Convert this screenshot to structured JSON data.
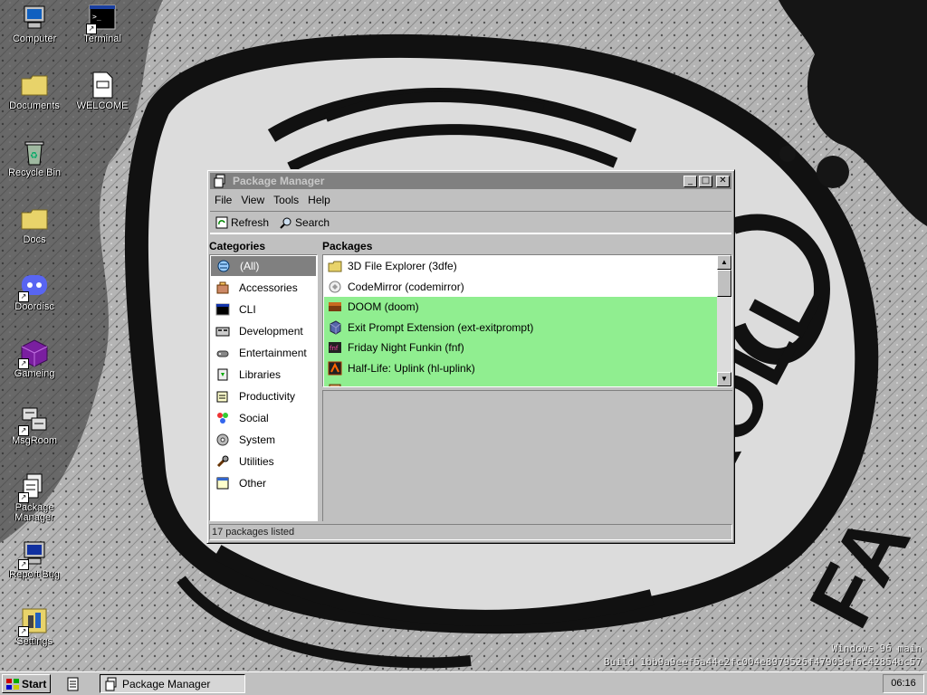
{
  "wallpaper": {
    "text_line1": "Windows 96 main",
    "text_line2": "Build 1bb9a9eef5a44e2fc004e8979526f47903ef6c42854bc57"
  },
  "desktop_icons": [
    {
      "label": "Computer",
      "icon": "computer-icon",
      "shortcut": false
    },
    {
      "label": "Terminal",
      "icon": "terminal-icon",
      "shortcut": true
    },
    {
      "label": "Documents",
      "icon": "folder-icon",
      "shortcut": false
    },
    {
      "label": "WELCOME",
      "icon": "document-icon",
      "shortcut": false
    },
    {
      "label": "Recycle Bin",
      "icon": "recycle-bin-icon",
      "shortcut": false
    },
    {
      "label": "Docs",
      "icon": "folder-icon",
      "shortcut": false
    },
    {
      "label": "Doordisc",
      "icon": "discord-icon",
      "shortcut": true
    },
    {
      "label": "Gameing",
      "icon": "game-cube-icon",
      "shortcut": true
    },
    {
      "label": "MsgRoom",
      "icon": "chat-computers-icon",
      "shortcut": true
    },
    {
      "label": "Package Manager",
      "icon": "package-manager-icon",
      "shortcut": true
    },
    {
      "label": "Report Bug",
      "icon": "computer-bug-icon",
      "shortcut": true
    },
    {
      "label": "Settings",
      "icon": "settings-icon",
      "shortcut": true
    }
  ],
  "window": {
    "title": "Package Manager",
    "menu": [
      "File",
      "View",
      "Tools",
      "Help"
    ],
    "toolbar": {
      "refresh_label": "Refresh",
      "search_label": "Search"
    },
    "categories_heading": "Categories",
    "packages_heading": "Packages",
    "categories": [
      {
        "label": "(All)",
        "icon": "all-icon",
        "selected": true
      },
      {
        "label": "Accessories",
        "icon": "accessories-icon",
        "selected": false
      },
      {
        "label": "CLI",
        "icon": "cli-icon",
        "selected": false
      },
      {
        "label": "Development",
        "icon": "development-icon",
        "selected": false
      },
      {
        "label": "Entertainment",
        "icon": "entertainment-icon",
        "selected": false
      },
      {
        "label": "Libraries",
        "icon": "libraries-icon",
        "selected": false
      },
      {
        "label": "Productivity",
        "icon": "productivity-icon",
        "selected": false
      },
      {
        "label": "Social",
        "icon": "social-icon",
        "selected": false
      },
      {
        "label": "System",
        "icon": "system-icon",
        "selected": false
      },
      {
        "label": "Utilities",
        "icon": "utilities-icon",
        "selected": false
      },
      {
        "label": "Other",
        "icon": "other-icon",
        "selected": false
      }
    ],
    "packages": [
      {
        "label": "3D File Explorer (3dfe)",
        "icon": "folder-icon",
        "installed": false
      },
      {
        "label": "CodeMirror (codemirror)",
        "icon": "codemirror-icon",
        "installed": false
      },
      {
        "label": "DOOM (doom)",
        "icon": "doom-icon",
        "installed": true
      },
      {
        "label": "Exit Prompt Extension (ext-exitprompt)",
        "icon": "extension-icon",
        "installed": true
      },
      {
        "label": "Friday Night Funkin (fnf)",
        "icon": "fnf-icon",
        "installed": true
      },
      {
        "label": "Half-Life: Uplink (hl-uplink)",
        "icon": "half-life-icon",
        "installed": true
      },
      {
        "label": "",
        "icon": "package-icon",
        "installed": true
      }
    ],
    "status": "17 packages listed"
  },
  "taskbar": {
    "start_label": "Start",
    "task_label": "Package Manager",
    "clock": "06:16"
  },
  "colors": {
    "installed_row": "#90ee90",
    "title_bar_inactive": "#808080",
    "face": "#c0c0c0"
  }
}
